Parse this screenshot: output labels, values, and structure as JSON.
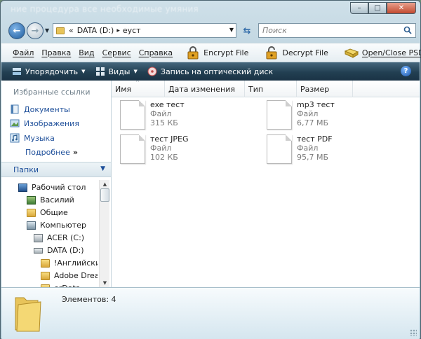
{
  "window": {
    "title_ghost": "ние процедура все необходимые умяния",
    "minimize": "–",
    "maximize": "□",
    "close": "✕"
  },
  "address": {
    "prefix": "«",
    "drive": "DATA (D:)",
    "sep": "▸",
    "folder": "eycт"
  },
  "search": {
    "placeholder": "Поиск"
  },
  "menu": {
    "items": [
      "Файл",
      "Правка",
      "Вид",
      "Сервис",
      "Справка"
    ],
    "encrypt": "Encrypt File",
    "decrypt": "Decrypt File",
    "openclose": "Open/Close PSD"
  },
  "commands": {
    "organize": "Упорядочить",
    "views": "Виды",
    "burn": "Запись на оптический диск",
    "help": "?"
  },
  "favorites": {
    "title": "Избранные ссылки",
    "links": [
      "Документы",
      "Изображения",
      "Музыка"
    ],
    "more": "Подробнее",
    "more_arrow": "»"
  },
  "folders": {
    "title": "Папки",
    "tree": [
      "Рабочий стол",
      "Василий",
      "Общие",
      "Компьютер",
      "ACER (C:)",
      "DATA (D:)",
      "!Английский",
      "Adobe Dream",
      "erData"
    ]
  },
  "columns": [
    "Имя",
    "Дата изменения",
    "Тип",
    "Размер"
  ],
  "files": [
    {
      "name": "exe тест",
      "type": "Файл",
      "size": "315 КБ"
    },
    {
      "name": "mp3 тест",
      "type": "Файл",
      "size": "6,77 МБ"
    },
    {
      "name": "тест JPEG",
      "type": "Файл",
      "size": "102 КБ"
    },
    {
      "name": "тест PDF",
      "type": "Файл",
      "size": "95,7 МБ"
    }
  ],
  "details": {
    "count": "Элементов: 4"
  },
  "icons": {
    "back": "arrow-left-icon",
    "forward": "arrow-right-icon",
    "refresh": "refresh-icon",
    "search": "search-icon",
    "lock": "lock-icon",
    "folder": "folder-icon",
    "file": "file-icon"
  },
  "colors": {
    "commandbar": "#223f52",
    "link": "#1e4f9a",
    "folder": "#e8c45a"
  }
}
